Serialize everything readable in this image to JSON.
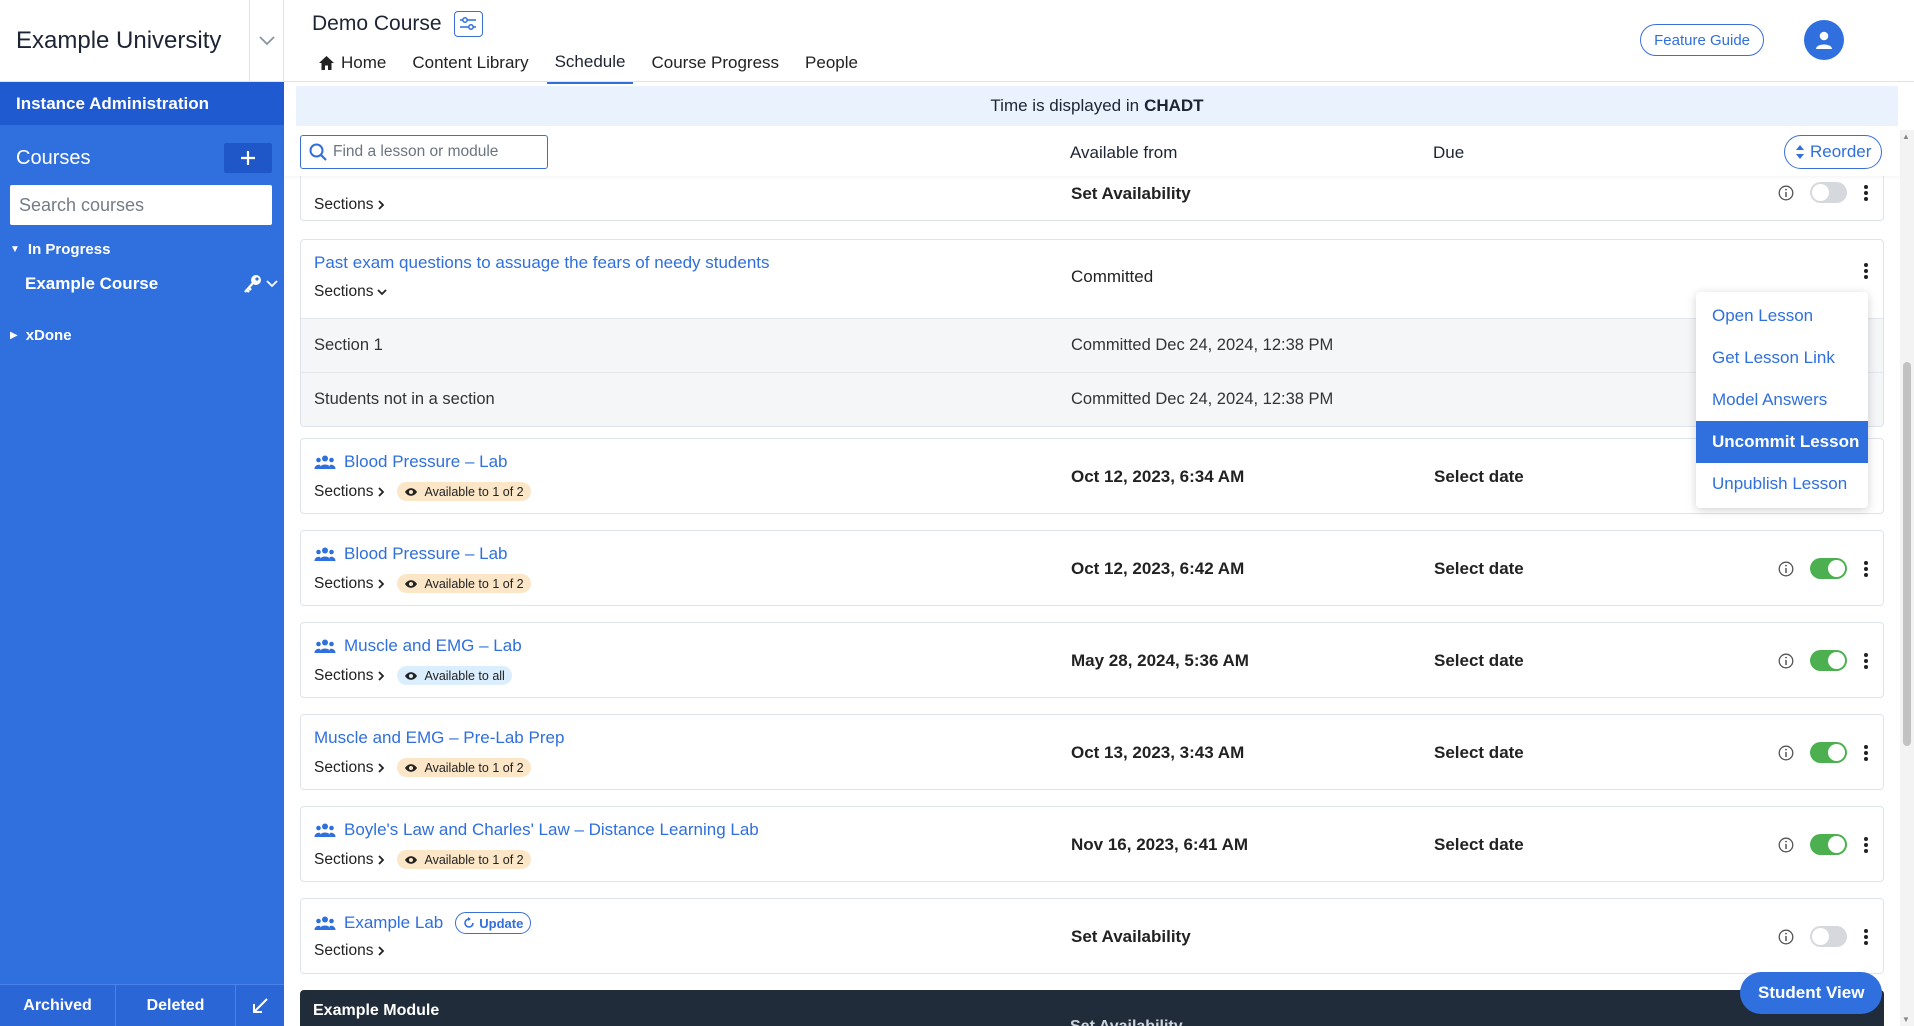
{
  "sidebar": {
    "university": "Example University",
    "instance_admin": "Instance Administration",
    "courses_label": "Courses",
    "search_placeholder": "Search courses",
    "group_in_progress": "In Progress",
    "course_name": "Example Course",
    "group_done": "xDone",
    "archived": "Archived",
    "deleted": "Deleted"
  },
  "header": {
    "course_title": "Demo Course",
    "tabs": [
      {
        "label": "Home"
      },
      {
        "label": "Content Library"
      },
      {
        "label": "Schedule",
        "active": true
      },
      {
        "label": "Course Progress"
      },
      {
        "label": "People"
      }
    ],
    "feature_guide": "Feature Guide"
  },
  "banner": {
    "prefix": "Time is displayed in",
    "timezone": "CHADT"
  },
  "columns": {
    "search_placeholder": "Find a lesson or module",
    "available_from": "Available from",
    "due": "Due",
    "reorder": "Reorder"
  },
  "lessons": [
    {
      "title": "",
      "sections": "Sections",
      "available": "Set Availability",
      "toggle": "off"
    },
    {
      "title": "Past exam questions to assuage the fears of needy students",
      "sections": "Sections",
      "available": "Committed",
      "subrows": [
        {
          "name": "Section 1",
          "value": "Committed Dec 24, 2024, 12:38 PM"
        },
        {
          "name": "Students not in a section",
          "value": "Committed Dec 24, 2024, 12:38 PM"
        }
      ]
    },
    {
      "title": "Blood Pressure – Lab",
      "sections": "Sections",
      "badge": "Available to 1 of 2",
      "available": "Oct 12, 2023, 6:34 AM",
      "due": "Select date"
    },
    {
      "title": "Blood Pressure – Lab",
      "sections": "Sections",
      "badge": "Available to 1 of 2",
      "available": "Oct 12, 2023, 6:42 AM",
      "due": "Select date",
      "toggle": "on"
    },
    {
      "title": "Muscle and EMG – Lab",
      "sections": "Sections",
      "badge": "Available to all",
      "available": "May 28, 2024, 5:36 AM",
      "due": "Select date",
      "toggle": "on"
    },
    {
      "title": "Muscle and EMG – Pre-Lab Prep",
      "sections": "Sections",
      "badge": "Available to 1 of 2",
      "available": "Oct 13, 2023, 3:43 AM",
      "due": "Select date",
      "toggle": "on"
    },
    {
      "title": "Boyle's Law and Charles' Law – Distance Learning Lab",
      "sections": "Sections",
      "badge": "Available to 1 of 2",
      "available": "Nov 16, 2023, 6:41 AM",
      "due": "Select date",
      "toggle": "on"
    },
    {
      "title": "Example Lab",
      "update": "Update",
      "sections": "Sections",
      "available": "Set Availability",
      "toggle": "off"
    }
  ],
  "module": {
    "name": "Example Module",
    "available": "Set Availability"
  },
  "menu": {
    "items": [
      "Open Lesson",
      "Get Lesson Link",
      "Model Answers",
      "Uncommit Lesson",
      "Unpublish Lesson"
    ],
    "highlighted": "Uncommit Lesson"
  },
  "student_view": "Student View",
  "colors": {
    "primary": "#2f6fde",
    "sidebar": "#2f6fde",
    "toggle_on": "#4caf50",
    "badge_partial": "#fbe6c8",
    "badge_all": "#daeefd",
    "module_bar": "#212c3a"
  }
}
